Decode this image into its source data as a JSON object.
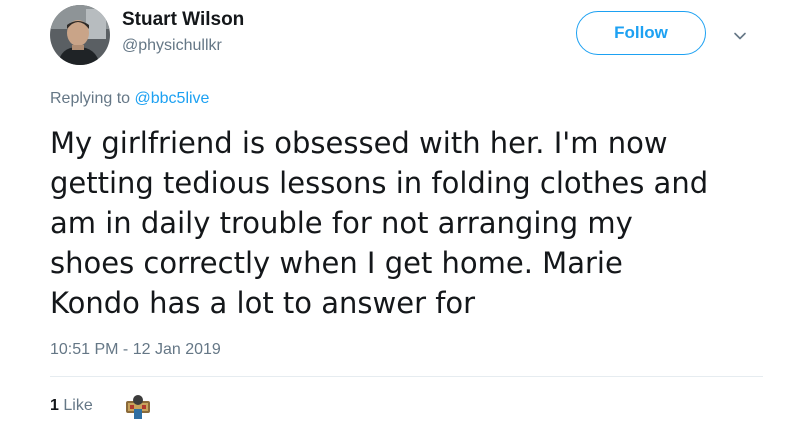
{
  "author": {
    "display_name": "Stuart Wilson",
    "handle": "@physichullkr",
    "avatar_icon": "user-avatar-photo"
  },
  "follow_button": {
    "label": "Follow",
    "accent_color": "#1da1f2"
  },
  "menu": {
    "icon": "chevron-down-icon"
  },
  "reply_context": {
    "prefix": "Replying to",
    "mention": "@bbc5live"
  },
  "tweet": {
    "text_lines": [
      "My girlfriend is obsessed with her. I'm now",
      "getting tedious lessons in folding clothes and",
      "am in daily trouble for not arranging my",
      "shoes correctly when I get home. Marie",
      "Kondo has a lot to answer for"
    ],
    "timestamp": "10:51 PM - 12 Jan 2019"
  },
  "engagement": {
    "like_count": "1",
    "like_label": "Like",
    "liker_avatar_icon": "liker-avatar"
  },
  "colors": {
    "text_primary": "#14171a",
    "text_secondary": "#657786",
    "link": "#1da1f2",
    "divider": "#e6ecf0"
  }
}
